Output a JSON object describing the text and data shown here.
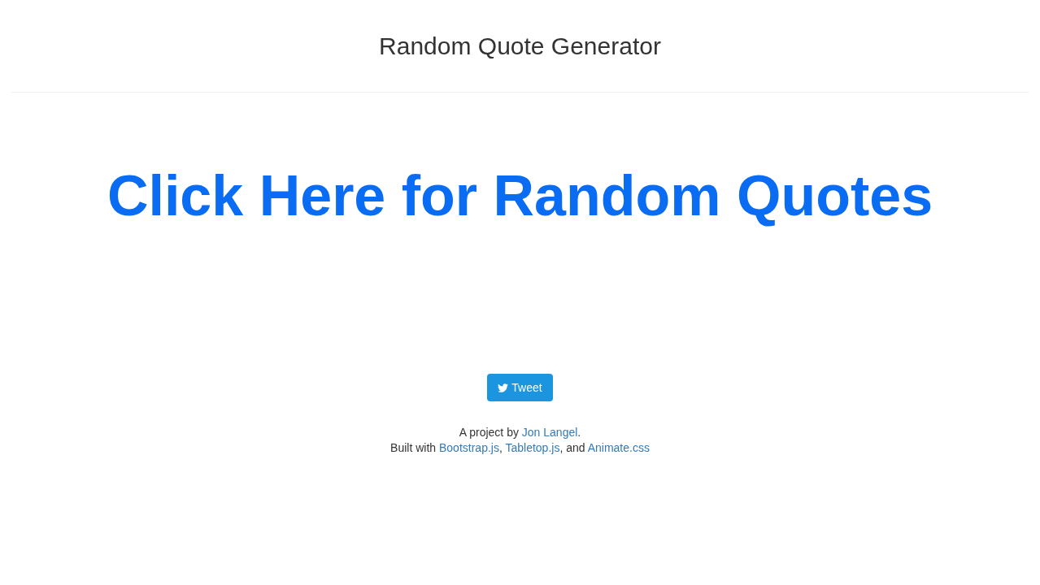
{
  "header": {
    "title": "Random Quote Generator"
  },
  "quote_link": "Click Here for Random Quotes",
  "tweet_button": {
    "label": "Tweet"
  },
  "footer": {
    "lines": [
      [
        {
          "kind": "text",
          "text": "A project by "
        },
        {
          "kind": "link",
          "text": "Jon Langel"
        },
        {
          "kind": "text",
          "text": "."
        }
      ],
      [
        {
          "kind": "text",
          "text": "Built with "
        },
        {
          "kind": "link",
          "text": "Bootstrap.js"
        },
        {
          "kind": "text",
          "text": ", "
        },
        {
          "kind": "link",
          "text": "Tabletop.js"
        },
        {
          "kind": "text",
          "text": ", and "
        },
        {
          "kind": "link",
          "text": "Animate.css"
        }
      ]
    ]
  }
}
